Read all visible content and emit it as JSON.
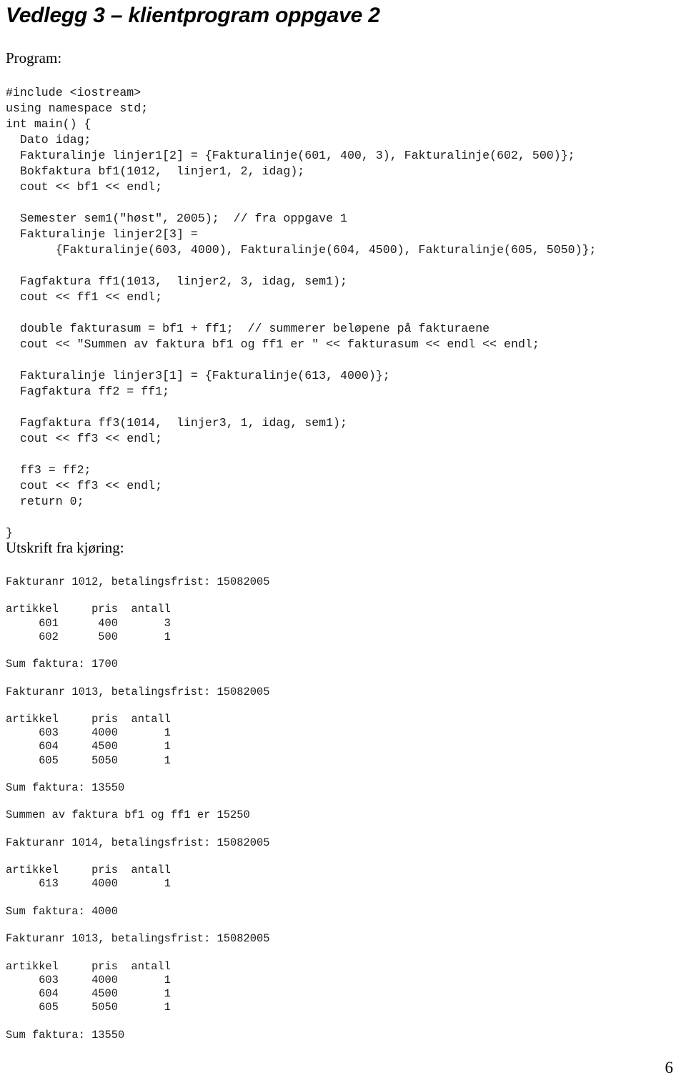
{
  "document": {
    "title": "Vedlegg 3 – klientprogram oppgave 2",
    "page_number": "6"
  },
  "sections": {
    "program_heading": "Program:",
    "output_heading": "Utskrift fra kjøring:"
  },
  "program_listing": {
    "language": "C++",
    "lines": [
      "#include <iostream>",
      "using namespace std;",
      "int main() {",
      "  Dato idag;",
      "  Fakturalinje linjer1[2] = {Fakturalinje(601, 400, 3), Fakturalinje(602, 500)};",
      "  Bokfaktura bf1(1012,  linjer1, 2, idag);",
      "  cout << bf1 << endl;",
      "",
      "  Semester sem1(\"høst\", 2005);  // fra oppgave 1",
      "  Fakturalinje linjer2[3] =",
      "       {Fakturalinje(603, 4000), Fakturalinje(604, 4500), Fakturalinje(605, 5050)};",
      "",
      "  Fagfaktura ff1(1013,  linjer2, 3, idag, sem1);",
      "  cout << ff1 << endl;",
      "",
      "  double fakturasum = bf1 + ff1;  // summerer beløpene på fakturaene",
      "  cout << \"Summen av faktura bf1 og ff1 er \" << fakturasum << endl << endl;",
      "",
      "  Fakturalinje linjer3[1] = {Fakturalinje(613, 4000)};",
      "  Fagfaktura ff2 = ff1;",
      "",
      "  Fagfaktura ff3(1014,  linjer3, 1, idag, sem1);",
      "  cout << ff3 << endl;",
      "",
      "  ff3 = ff2;",
      "  cout << ff3 << endl;",
      "  return 0;",
      "",
      "}"
    ],
    "text": "#include <iostream>\nusing namespace std;\nint main() {\n  Dato idag;\n  Fakturalinje linjer1[2] = {Fakturalinje(601, 400, 3), Fakturalinje(602, 500)};\n  Bokfaktura bf1(1012,  linjer1, 2, idag);\n  cout << bf1 << endl;\n\n  Semester sem1(\"høst\", 2005);  // fra oppgave 1\n  Fakturalinje linjer2[3] =\n       {Fakturalinje(603, 4000), Fakturalinje(604, 4500), Fakturalinje(605, 5050)};\n\n  Fagfaktura ff1(1013,  linjer2, 3, idag, sem1);\n  cout << ff1 << endl;\n\n  double fakturasum = bf1 + ff1;  // summerer beløpene på fakturaene\n  cout << \"Summen av faktura bf1 og ff1 er \" << fakturasum << endl << endl;\n\n  Fakturalinje linjer3[1] = {Fakturalinje(613, 4000)};\n  Fagfaktura ff2 = ff1;\n\n  Fagfaktura ff3(1014,  linjer3, 1, idag, sem1);\n  cout << ff3 << endl;\n\n  ff3 = ff2;\n  cout << ff3 << endl;\n  return 0;\n\n}"
  },
  "run_output": {
    "column_headers": [
      "artikkel",
      "pris",
      "antall"
    ],
    "invoices": [
      {
        "header": "Fakturanr 1012, betalingsfrist: 15082005",
        "invoice_number": "1012",
        "due_date": "15082005",
        "rows": [
          {
            "artikkel": "601",
            "pris": "400",
            "antall": "3"
          },
          {
            "artikkel": "602",
            "pris": "500",
            "antall": "1"
          }
        ],
        "sum_label": "Sum faktura:",
        "sum_value": "1700"
      },
      {
        "header": "Fakturanr 1013, betalingsfrist: 15082005",
        "invoice_number": "1013",
        "due_date": "15082005",
        "rows": [
          {
            "artikkel": "603",
            "pris": "4000",
            "antall": "1"
          },
          {
            "artikkel": "604",
            "pris": "4500",
            "antall": "1"
          },
          {
            "artikkel": "605",
            "pris": "5050",
            "antall": "1"
          }
        ],
        "sum_label": "Sum faktura:",
        "sum_value": "13550"
      },
      {
        "header": "Fakturanr 1014, betalingsfrist: 15082005",
        "invoice_number": "1014",
        "due_date": "15082005",
        "rows": [
          {
            "artikkel": "613",
            "pris": "4000",
            "antall": "1"
          }
        ],
        "sum_label": "Sum faktura:",
        "sum_value": "4000"
      },
      {
        "header": "Fakturanr 1013, betalingsfrist: 15082005",
        "invoice_number": "1013",
        "due_date": "15082005",
        "rows": [
          {
            "artikkel": "603",
            "pris": "4000",
            "antall": "1"
          },
          {
            "artikkel": "604",
            "pris": "4500",
            "antall": "1"
          },
          {
            "artikkel": "605",
            "pris": "5050",
            "antall": "1"
          }
        ],
        "sum_label": "Sum faktura:",
        "sum_value": "13550"
      }
    ],
    "summary_line": "Summen av faktura bf1 og ff1 er 15250",
    "summary_value": "15250",
    "text": "Fakturanr 1012, betalingsfrist: 15082005\n\nartikkel     pris  antall\n     601      400       3\n     602      500       1\n\nSum faktura: 1700\n\nFakturanr 1013, betalingsfrist: 15082005\n\nartikkel     pris  antall\n     603     4000       1\n     604     4500       1\n     605     5050       1\n\nSum faktura: 13550\n\nSummen av faktura bf1 og ff1 er 15250\n\nFakturanr 1014, betalingsfrist: 15082005\n\nartikkel     pris  antall\n     613     4000       1\n\nSum faktura: 4000\n\nFakturanr 1013, betalingsfrist: 15082005\n\nartikkel     pris  antall\n     603     4000       1\n     604     4500       1\n     605     5050       1\n\nSum faktura: 13550"
  },
  "colors": {
    "page_background": "#ffffff",
    "body_text": "#000000",
    "code_text": "#1a1a1a"
  }
}
